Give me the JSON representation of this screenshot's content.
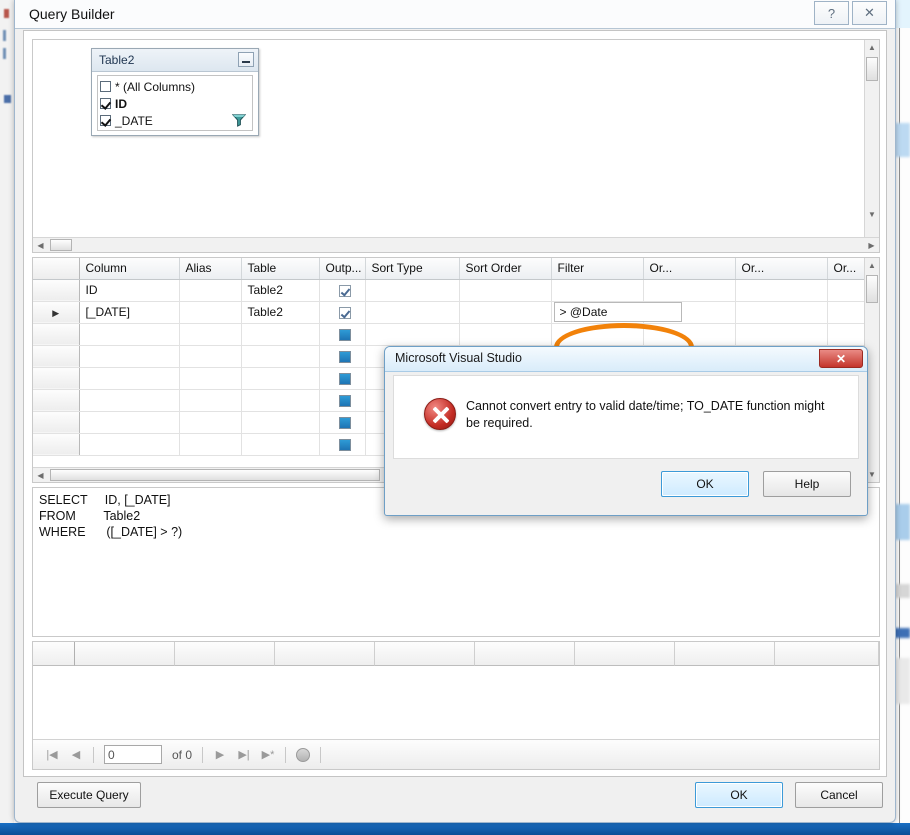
{
  "window": {
    "title": "Query Builder",
    "help_button": "?",
    "close_button": "✕"
  },
  "diagram": {
    "table_box": {
      "title": "Table2",
      "minimize_label": "_",
      "columns": [
        {
          "label": "* (All Columns)",
          "checked": false,
          "bold": false
        },
        {
          "label": "ID",
          "checked": true,
          "bold": true
        },
        {
          "label": "_DATE",
          "checked": true,
          "bold": false
        }
      ],
      "filter_icon": "filter-funnel-icon"
    },
    "hscroll_left_arrow": "◀",
    "hscroll_right_arrow": "▶",
    "vscroll_up_arrow": "▲",
    "vscroll_down_arrow": "▼"
  },
  "criteria_grid": {
    "headers": [
      "",
      "Column",
      "Alias",
      "Table",
      "Outp...",
      "Sort Type",
      "Sort Order",
      "Filter",
      "Or...",
      "Or...",
      "Or..."
    ],
    "rows": [
      {
        "marker": "",
        "column": "ID",
        "alias": "",
        "table": "Table2",
        "output": "checked",
        "sort_type": "",
        "sort_order": "",
        "filter": "",
        "or1": "",
        "or2": "",
        "or3": ""
      },
      {
        "marker": "▶",
        "column": "[_DATE]",
        "alias": "",
        "table": "Table2",
        "output": "checked",
        "sort_type": "",
        "sort_order": "",
        "filter": "> @Date",
        "or1": "",
        "or2": "",
        "or3": ""
      },
      {
        "marker": "",
        "column": "",
        "alias": "",
        "table": "",
        "output": "blue",
        "sort_type": "",
        "sort_order": "",
        "filter": "",
        "or1": "",
        "or2": "",
        "or3": ""
      },
      {
        "marker": "",
        "column": "",
        "alias": "",
        "table": "",
        "output": "blue",
        "sort_type": "",
        "sort_order": "",
        "filter": "",
        "or1": "",
        "or2": "",
        "or3": ""
      },
      {
        "marker": "",
        "column": "",
        "alias": "",
        "table": "",
        "output": "blue",
        "sort_type": "",
        "sort_order": "",
        "filter": "",
        "or1": "",
        "or2": "",
        "or3": ""
      },
      {
        "marker": "",
        "column": "",
        "alias": "",
        "table": "",
        "output": "blue",
        "sort_type": "",
        "sort_order": "",
        "filter": "",
        "or1": "",
        "or2": "",
        "or3": ""
      },
      {
        "marker": "",
        "column": "",
        "alias": "",
        "table": "",
        "output": "blue",
        "sort_type": "",
        "sort_order": "",
        "filter": "",
        "or1": "",
        "or2": "",
        "or3": ""
      },
      {
        "marker": "",
        "column": "",
        "alias": "",
        "table": "",
        "output": "blue",
        "sort_type": "",
        "sort_order": "",
        "filter": "",
        "or1": "",
        "or2": "",
        "or3": ""
      }
    ],
    "annotation": {
      "shape": "ellipse",
      "color": "#f2820a",
      "targets": "filter-cell-date"
    }
  },
  "sql_pane": {
    "text": "SELECT     ID, [_DATE]\nFROM        Table2\nWHERE      ([_DATE] > ?)"
  },
  "results": {
    "column_count": 8,
    "rows": [],
    "nav": {
      "first_label": "|◀",
      "prev_label": "◀",
      "page_value": "0",
      "of_label": "of 0",
      "next_label": "▶",
      "last_label": "▶|",
      "new_label": "▶*",
      "stop_label": "stop-icon"
    }
  },
  "footer": {
    "execute_query": "Execute Query",
    "ok": "OK",
    "cancel": "Cancel"
  },
  "dialog": {
    "title": "Microsoft Visual Studio",
    "close_label": "✕",
    "icon": "error-icon",
    "message": "Cannot convert entry to valid date/time; TO_DATE function might be required.",
    "ok_label": "OK",
    "help_label": "Help"
  }
}
